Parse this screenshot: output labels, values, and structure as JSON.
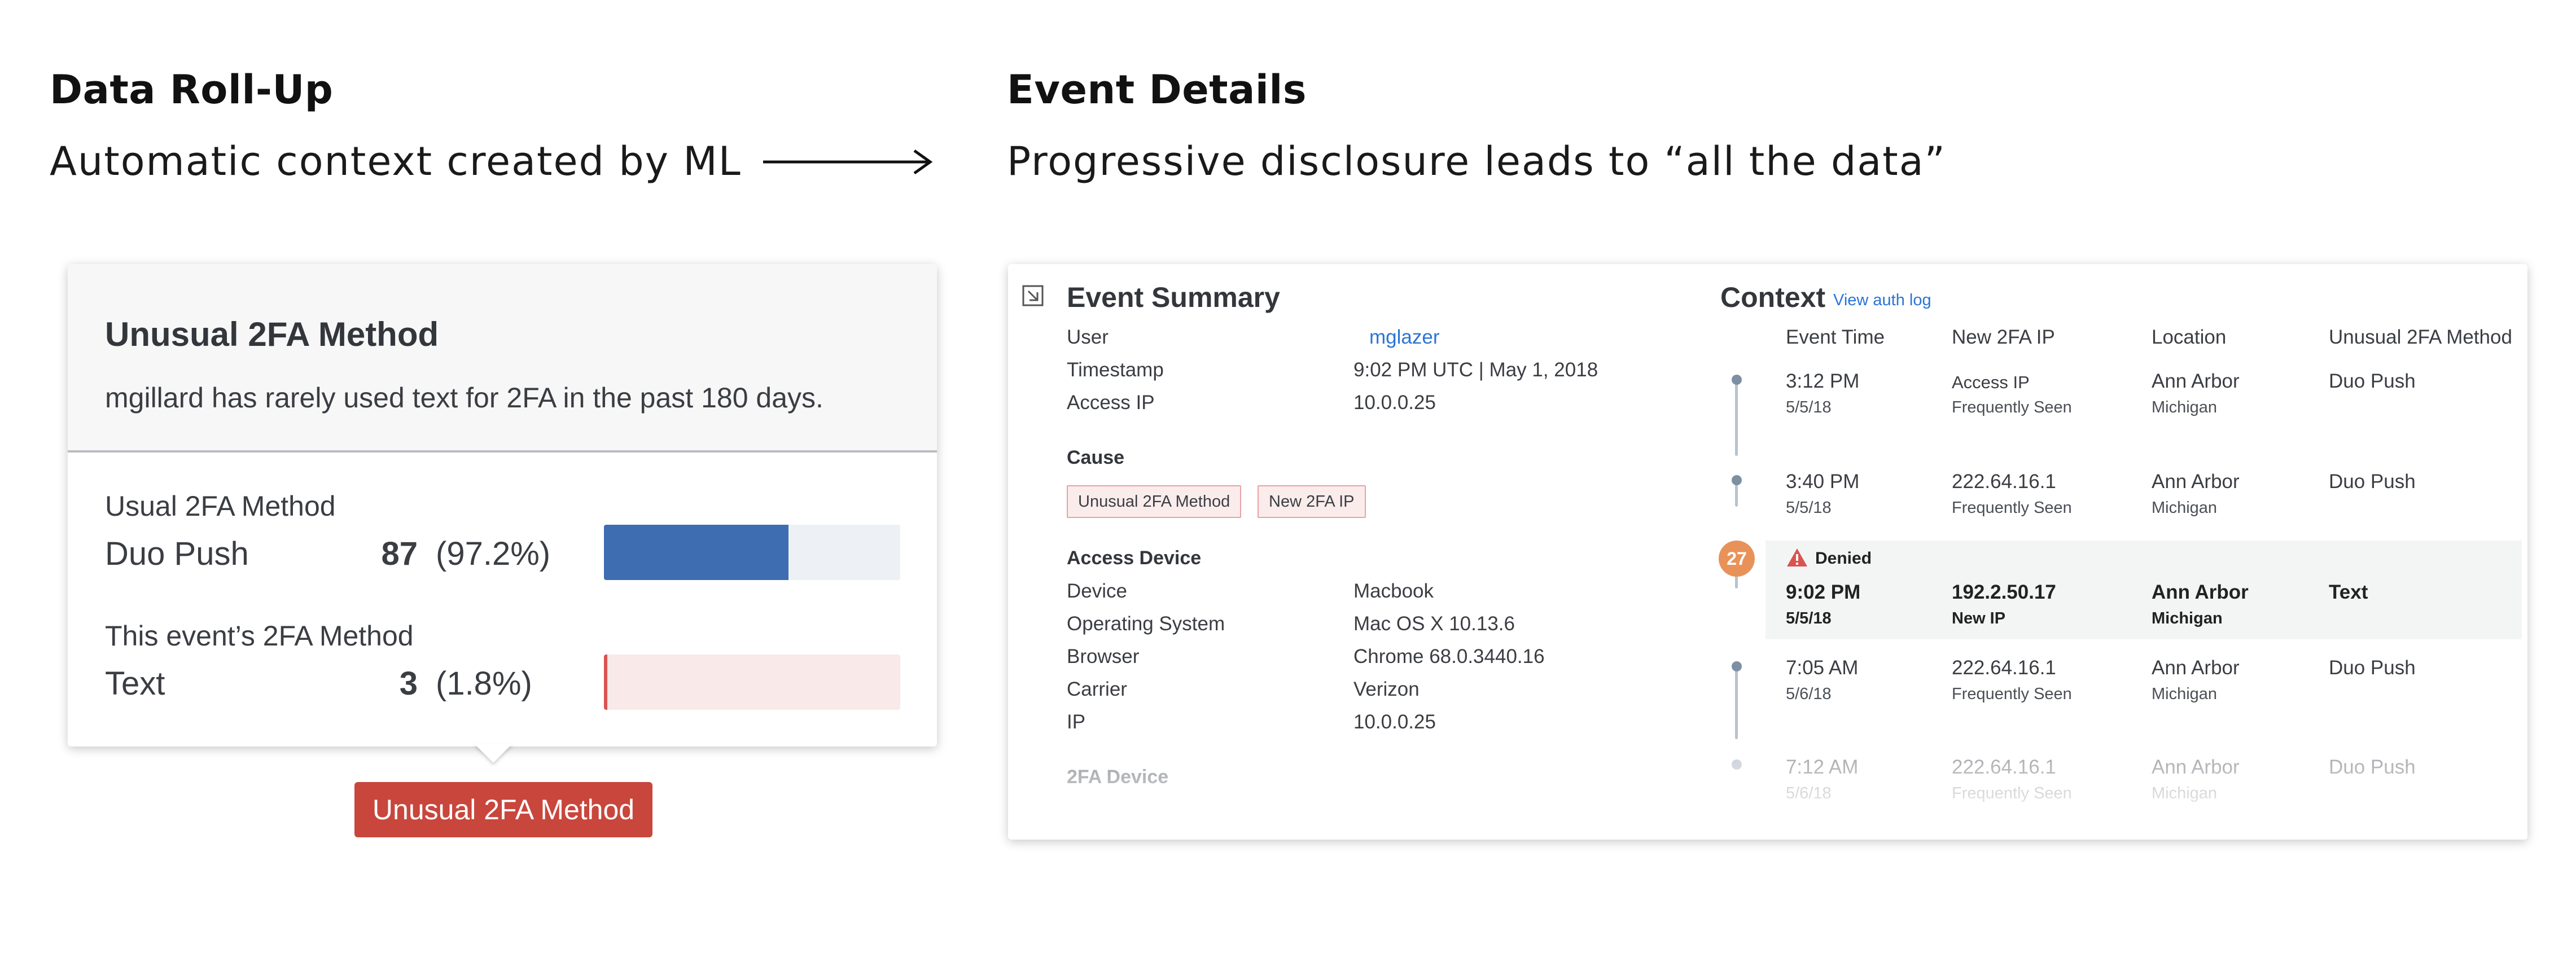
{
  "left": {
    "heading": "Data Roll-Up",
    "subheading": "Automatic context created by ML"
  },
  "right": {
    "heading": "Event Details",
    "subheading": "Progressive disclosure leads to “all the data”"
  },
  "rollup_card": {
    "title": "Unusual 2FA Method",
    "description": "mgillard has rarely used text for 2FA in the past 180 days.",
    "usual": {
      "label": "Usual 2FA Method",
      "name": "Duo Push",
      "count": "87",
      "percent": "(97.2%)",
      "fraction": 0.972
    },
    "this_event": {
      "label": "This event’s 2FA Method",
      "name": "Text",
      "count": "3",
      "percent": "(1.8%)",
      "fraction": 0.018
    },
    "colors": {
      "usual_bar": "#3f6db2",
      "usual_track": "#edf1f5",
      "event_bar": "#d9534f",
      "event_track": "#f9e9e9"
    }
  },
  "tag_button": "Unusual 2FA Method",
  "event_summary": {
    "icon": "expand-icon",
    "title": "Event Summary",
    "user_label": "User",
    "user_value": "mglazer",
    "timestamp_label": "Timestamp",
    "timestamp_value": "9:02 PM UTC | May 1, 2018",
    "access_ip_label": "Access IP",
    "access_ip_value": "10.0.0.25",
    "cause_title": "Cause",
    "cause_tags": [
      "Unusual 2FA Method",
      "New 2FA IP"
    ],
    "access_device_title": "Access Device",
    "device_label": "Device",
    "device_value": "Macbook",
    "os_label": "Operating System",
    "os_value": "Mac OS X 10.13.6",
    "browser_label": "Browser",
    "browser_value": "Chrome 68.0.3440.16",
    "carrier_label": "Carrier",
    "carrier_value": "Verizon",
    "ip_label": "IP",
    "ip_value": "10.0.0.25",
    "twofa_device_title": "2FA Device"
  },
  "context": {
    "title": "Context",
    "link": "View auth log",
    "columns": [
      "Event Time",
      "New 2FA IP",
      "Location",
      "Unusual 2FA Method"
    ],
    "badge": "27",
    "denied_label": "Denied",
    "rows": [
      {
        "time": "3:12 PM",
        "date": "5/5/18",
        "ip": "Access IP",
        "ip_note": "Frequently Seen",
        "location": "Ann Arbor",
        "region": "Michigan",
        "method": "Duo Push"
      },
      {
        "time": "3:40 PM",
        "date": "5/5/18",
        "ip": "222.64.16.1",
        "ip_note": "Frequently Seen",
        "location": "Ann Arbor",
        "region": "Michigan",
        "method": "Duo Push"
      },
      {
        "time": "9:02 PM",
        "date": "5/5/18",
        "ip": "192.2.50.17",
        "ip_note": "New IP",
        "location": "Ann Arbor",
        "region": "Michigan",
        "method": "Text"
      },
      {
        "time": "7:05 AM",
        "date": "5/6/18",
        "ip": "222.64.16.1",
        "ip_note": "Frequently Seen",
        "location": "Ann Arbor",
        "region": "Michigan",
        "method": "Duo Push"
      },
      {
        "time": "7:12 AM",
        "date": "5/6/18",
        "ip": "222.64.16.1",
        "ip_note": "Frequently Seen",
        "location": "Ann Arbor",
        "region": "Michigan",
        "method": "Duo Push"
      }
    ]
  }
}
